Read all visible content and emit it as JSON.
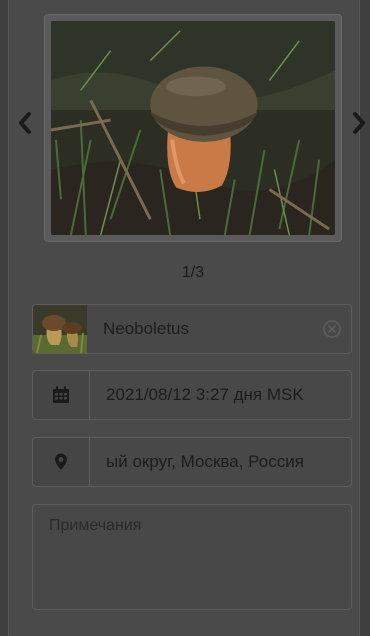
{
  "gallery": {
    "counter": "1/3",
    "prev_icon": "chevron-left-icon",
    "next_icon": "chevron-right-icon"
  },
  "taxon": {
    "name": "Neoboletus",
    "clear_icon": "clear-circle-icon"
  },
  "date": {
    "value": "2021/08/12 3:27 дня MSK",
    "icon": "calendar-icon"
  },
  "location": {
    "value": "ый округ, Москва, Россия",
    "icon": "map-marker-icon"
  },
  "notes": {
    "placeholder": "Примечания"
  }
}
